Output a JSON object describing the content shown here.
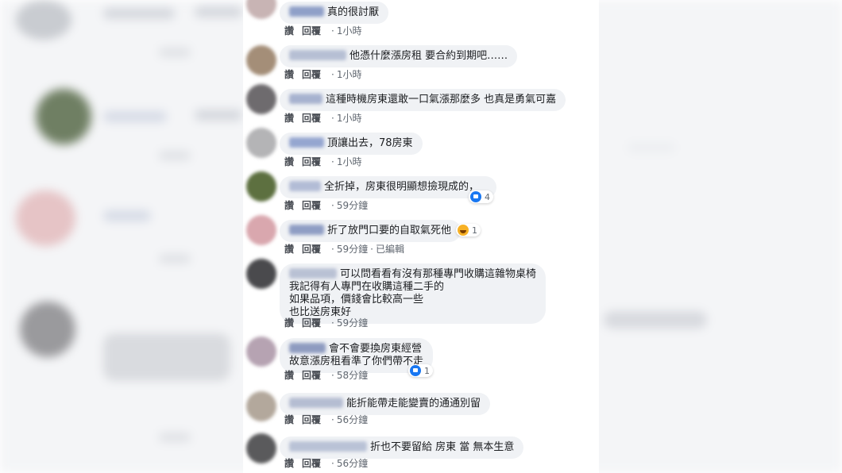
{
  "actions": {
    "like": "讚",
    "reply": "回覆",
    "edited": "已編輯"
  },
  "comments": [
    {
      "text": "真的很討厭",
      "time": "1小時"
    },
    {
      "text": "他憑什麼漲房租 要合約到期吧……",
      "time": "1小時"
    },
    {
      "text": "這種時機房東還敢一口氣漲那麼多 也真是勇氣可嘉",
      "time": "1小時"
    },
    {
      "text": "頂讓出去，78房東",
      "time": "1小時"
    },
    {
      "text": "全折掉，房東很明顯想撿現成的，",
      "time": "59分鐘",
      "reaction_count": "4",
      "reaction_icon": "like-icon"
    },
    {
      "text": "折了放門口要的自取氣死他",
      "time": "59分鐘",
      "reaction_count": "1",
      "reaction_icon": "haha-icon"
    },
    {
      "lines": [
        "可以問看看有沒有那種專門收購這雜物桌椅",
        "我記得有人專門在收購這種二手的",
        "如果品項，價錢會比較高一些",
        "也比送房東好"
      ],
      "time": "59分鐘"
    },
    {
      "lines": [
        "會不會要換房東經營",
        "故意漲房租看準了你們帶不走"
      ],
      "time": "58分鐘",
      "reaction_count": "1",
      "reaction_icon": "like-icon"
    },
    {
      "text": "能折能帶走能變賣的通通別留",
      "time": "56分鐘"
    },
    {
      "text": "折也不要留給 房東 當 無本生意",
      "time": "56分鐘"
    }
  ],
  "colors": {
    "bubble": "#f0f2f5",
    "like_blue": "#1877f2",
    "meta_gray": "#606770"
  }
}
